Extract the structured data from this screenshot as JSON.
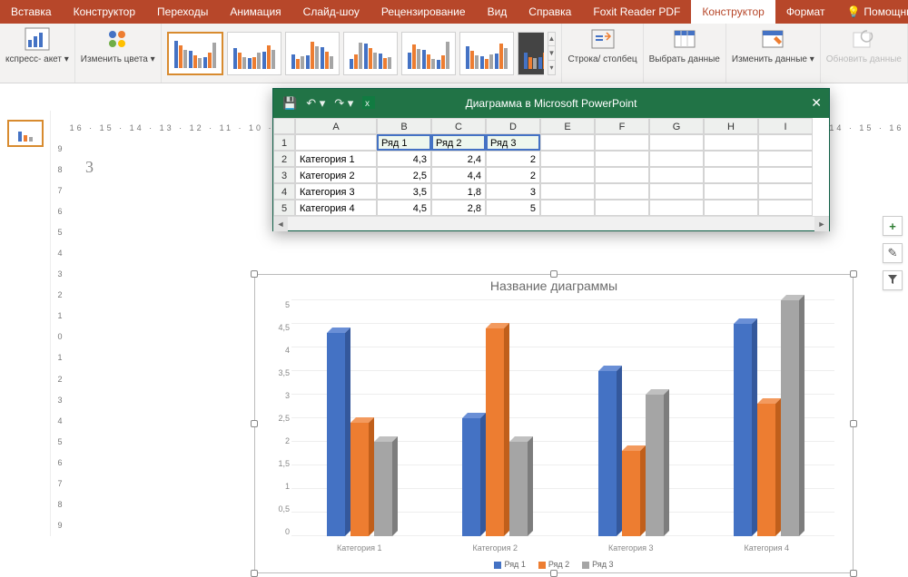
{
  "ribbon_tabs": {
    "items": [
      "Вставка",
      "Конструктор",
      "Переходы",
      "Анимация",
      "Слайд-шоу",
      "Рецензирование",
      "Вид",
      "Справка",
      "Foxit Reader PDF",
      "Конструктор",
      "Формат"
    ],
    "active_index": 9,
    "tell_me": "Помощник"
  },
  "ribbon": {
    "express_label": "кспресс-\nакет ▾",
    "colors_label": "Изменить\nцвета ▾",
    "rowcol_label": "Строка/\nстолбец",
    "select_data_label": "Выбрать\nданные",
    "edit_data_label": "Изменить\nданные ▾",
    "refresh_label": "Обновить\nданные"
  },
  "data_window": {
    "title": "Диаграмма в Microsoft PowerPoint",
    "columns": [
      "A",
      "B",
      "C",
      "D",
      "E",
      "F",
      "G",
      "H",
      "I"
    ],
    "row_numbers": [
      "1",
      "2",
      "3",
      "4",
      "5"
    ],
    "header_row": [
      "",
      "Ряд 1",
      "Ряд 2",
      "Ряд 3"
    ],
    "rows": [
      [
        "Категория 1",
        "4,3",
        "2,4",
        "2"
      ],
      [
        "Категория 2",
        "2,5",
        "4,4",
        "2"
      ],
      [
        "Категория 3",
        "3,5",
        "1,8",
        "3"
      ],
      [
        "Категория 4",
        "4,5",
        "2,8",
        "5"
      ]
    ]
  },
  "chart_data": {
    "type": "bar",
    "title": "Название диаграммы",
    "categories": [
      "Категория 1",
      "Категория 2",
      "Категория 3",
      "Категория 4"
    ],
    "series": [
      {
        "name": "Ряд 1",
        "values": [
          4.3,
          2.5,
          3.5,
          4.5
        ],
        "color": "#4472c4"
      },
      {
        "name": "Ряд 2",
        "values": [
          2.4,
          4.4,
          1.8,
          2.8
        ],
        "color": "#ed7d31"
      },
      {
        "name": "Ряд 3",
        "values": [
          2,
          2,
          3,
          5
        ],
        "color": "#a5a5a5"
      }
    ],
    "ylim": [
      0,
      5
    ],
    "yticks": [
      "0",
      "0,5",
      "1",
      "1,5",
      "2",
      "2,5",
      "3",
      "3,5",
      "4",
      "4,5",
      "5"
    ],
    "xlabel": "",
    "ylabel": ""
  },
  "ruler_h": "16 · 15 · 14 · 13 · 12 · 11 · 10 · 9 · 8 · 7 · 6 · 5 · 4 · 3 · 2 · 1 · 0 · 1 · 2 · 3 · 4 · 5 · 6 · 7 · 8 · 9 · 10 · 11 · 12 · 13 · 14 · 15 · 16",
  "ruler_v": [
    "9",
    "8",
    "7",
    "6",
    "5",
    "4",
    "3",
    "2",
    "1",
    "0",
    "1",
    "2",
    "3",
    "4",
    "5",
    "6",
    "7",
    "8",
    "9"
  ],
  "side_tools": {
    "plus": "+",
    "brush": "✎",
    "filter": "⌄"
  },
  "slide_big_index": "3"
}
